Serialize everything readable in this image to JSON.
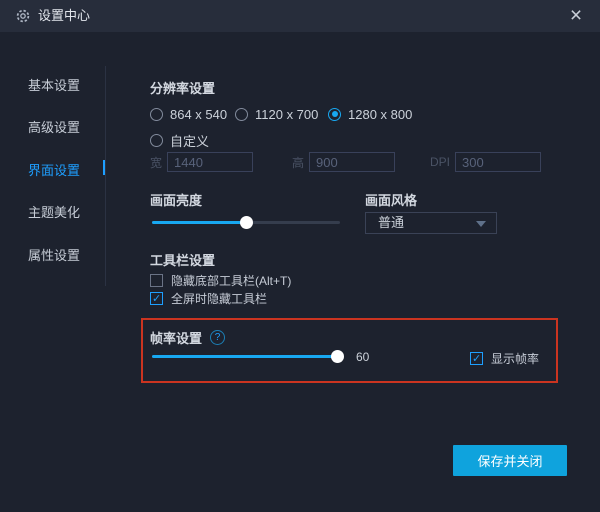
{
  "titlebar": {
    "title": "设置中心"
  },
  "sidebar": {
    "items": [
      {
        "label": "基本设置",
        "active": false
      },
      {
        "label": "高级设置",
        "active": false
      },
      {
        "label": "界面设置",
        "active": true
      },
      {
        "label": "主题美化",
        "active": false
      },
      {
        "label": "属性设置",
        "active": false
      }
    ]
  },
  "resolution": {
    "title": "分辨率设置",
    "presets": [
      {
        "label": "864 x 540",
        "selected": false
      },
      {
        "label": "1120 x 700",
        "selected": false
      },
      {
        "label": "1280 x 800",
        "selected": true
      }
    ],
    "custom": {
      "label": "自定义",
      "selected": false
    },
    "fields": [
      {
        "label": "宽",
        "value": "1440"
      },
      {
        "label": "高",
        "value": "900"
      },
      {
        "label": "DPI",
        "value": "300"
      }
    ]
  },
  "brightness": {
    "label": "画面亮度",
    "percent": 50
  },
  "style": {
    "label": "画面风格",
    "value": "普通"
  },
  "toolbar": {
    "title": "工具栏设置",
    "checkboxes": [
      {
        "label": "隐藏底部工具栏(Alt+T)",
        "checked": false
      },
      {
        "label": "全屏时隐藏工具栏",
        "checked": true
      }
    ]
  },
  "framerate": {
    "title": "帧率设置",
    "help_icon": "?",
    "percent": 100,
    "value": "60",
    "checkbox": {
      "label": "显示帧率",
      "checked": true
    }
  },
  "footer": {
    "save_label": "保存并关闭"
  },
  "colors": {
    "accent": "#18a8f1",
    "sidebar_active": "#1e9fff",
    "button": "#0fa3dd",
    "annotation_red": "#cb3420"
  }
}
